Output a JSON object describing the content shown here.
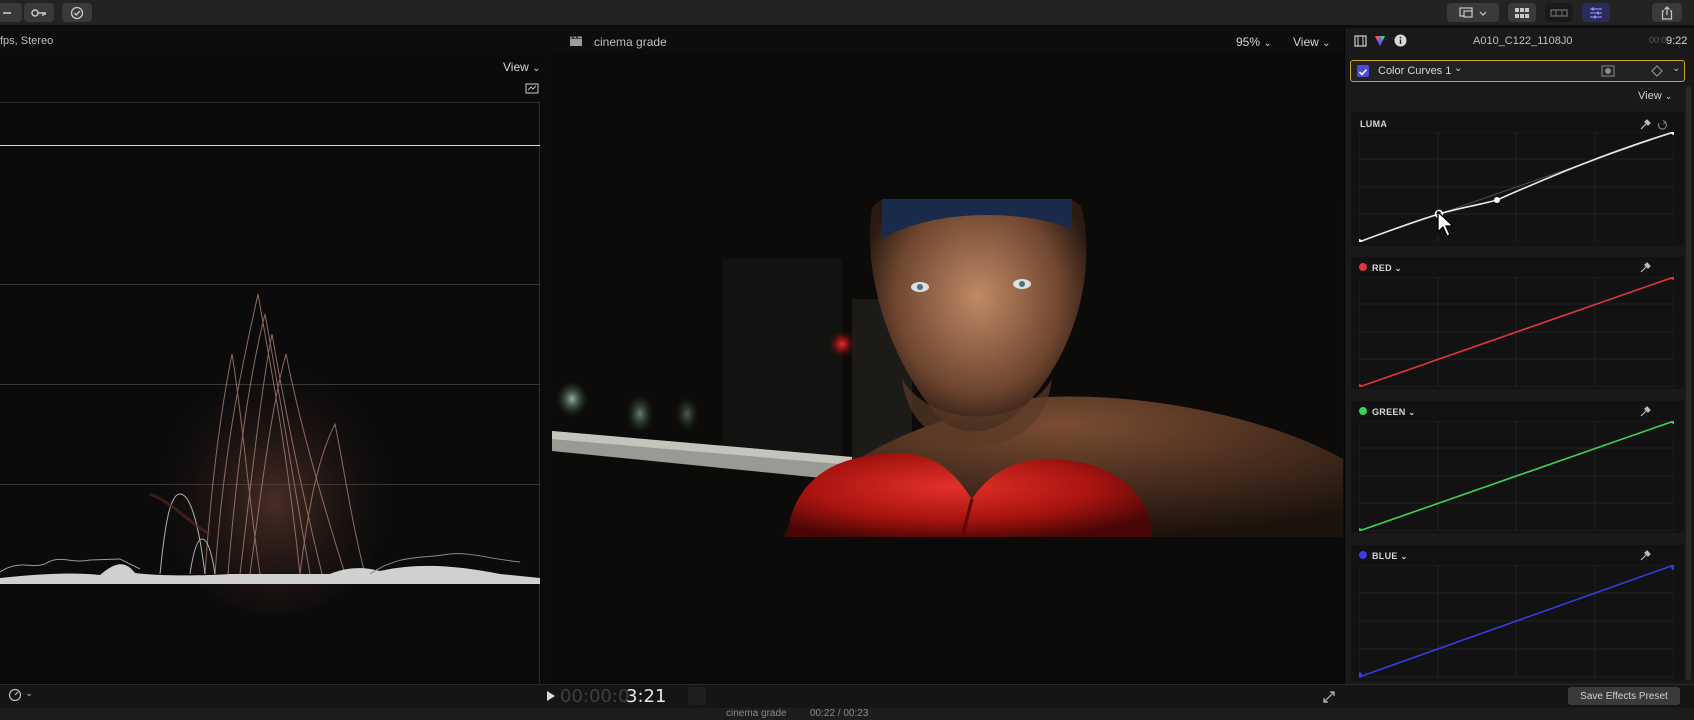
{
  "toolbar": {
    "icons": [
      "key-icon",
      "check-circle-icon",
      "monitor-icon",
      "grid-icon",
      "filmstrip-icon",
      "sliders-icon",
      "share-icon"
    ]
  },
  "browser_header": {
    "format_text": "fps, Stereo"
  },
  "scope": {
    "view_label": "View",
    "view_chevron": "⌄"
  },
  "viewer": {
    "title": "cinema grade",
    "zoom": "95%",
    "view_label": "View"
  },
  "inspector": {
    "clip_name": "A010_C122_1108J0",
    "duration": "9:22",
    "effect_name": "Color Curves 1",
    "view_label": "View",
    "curves": [
      {
        "label": "LUMA",
        "color": "#ffffff"
      },
      {
        "label": "RED",
        "color": "#e0353b"
      },
      {
        "label": "GREEN",
        "color": "#3fd05a"
      },
      {
        "label": "BLUE",
        "color": "#3a3ae6"
      }
    ],
    "save_preset_label": "Save Effects Preset"
  },
  "timecode": {
    "dim": "00:00:0",
    "bright": "3:21"
  },
  "footer": {
    "project": "cinema grade",
    "time": "00:22 / 00:23"
  }
}
